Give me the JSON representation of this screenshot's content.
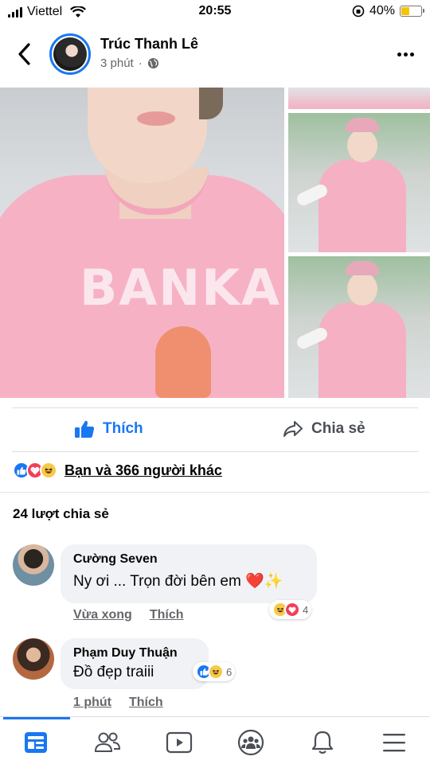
{
  "status_bar": {
    "carrier": "Viettel",
    "time": "20:55",
    "battery_percent": "40%",
    "battery_level": 0.4,
    "battery_color": "#f5c400"
  },
  "post": {
    "author_name": "Trúc Thanh Lê",
    "time_ago": "3 phút",
    "separator": "·",
    "privacy_icon": "globe-icon",
    "shirt_print": "BANKA$$"
  },
  "actions": {
    "like_label": "Thích",
    "share_label": "Chia sẻ"
  },
  "reactions": {
    "types": [
      "like",
      "love",
      "haha"
    ],
    "summary_text": "Bạn và 366 người khác"
  },
  "shares": {
    "text": "24 lượt chia sẻ"
  },
  "comments": [
    {
      "author": "Cường Seven",
      "text": "Ny ơi ... Trọn đời bên em ❤️✨",
      "time": "Vừa xong",
      "like_label": "Thích",
      "reaction_types": [
        "haha",
        "love"
      ],
      "reaction_count": "4"
    },
    {
      "author": "Phạm Duy Thuận",
      "text": "Đồ đẹp traiii",
      "time": "1 phút",
      "like_label": "Thích",
      "reaction_types": [
        "like",
        "haha"
      ],
      "reaction_count": "6"
    }
  ],
  "bottom_nav": {
    "items": [
      "news-feed-icon",
      "friends-icon",
      "watch-icon",
      "groups-icon",
      "notifications-icon",
      "menu-icon"
    ],
    "active_index": 0
  },
  "colors": {
    "accent": "#1877f2",
    "love": "#f33e58",
    "haha": "#f7c948",
    "secondary_text": "#65676b"
  }
}
